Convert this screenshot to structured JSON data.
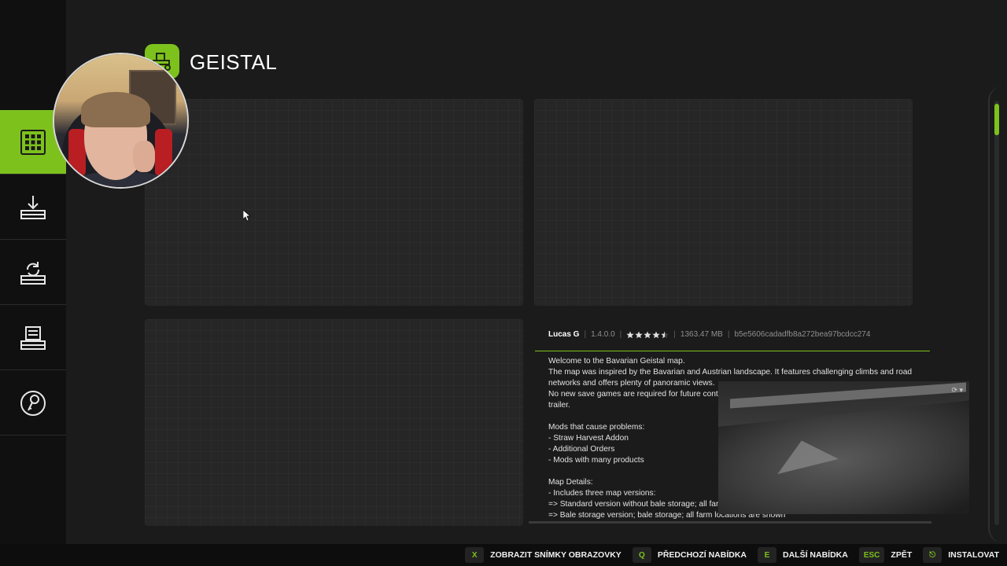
{
  "header": {
    "title": "GEISTAL"
  },
  "sidebar": {
    "items": [
      {
        "name": "mods-grid",
        "icon": "grid-icon",
        "active": true
      },
      {
        "name": "download",
        "icon": "download-icon",
        "active": false
      },
      {
        "name": "update",
        "icon": "refresh-icon",
        "active": false
      },
      {
        "name": "installed",
        "icon": "storage-icon",
        "active": false
      },
      {
        "name": "dlc",
        "icon": "key-icon",
        "active": false
      }
    ]
  },
  "details": {
    "author": "Lucas G",
    "version": "1.4.0.0",
    "rating": 4.5,
    "size": "1363.47 MB",
    "hash": "b5e5606cadadfb8a272bea97bcdcc274",
    "description_lines": [
      "Welcome to the Bavarian Geistal map.",
      "The map was inspired by the Bavarian and Austrian landscape. It features challenging climbs and road",
      "networks and offers plenty of panoramic views.",
      "No new save games are required for future cont",
      "trailer.",
      "",
      "Mods that cause problems:",
      "- Straw Harvest Addon",
      "- Additional Orders",
      "- Mods with many products",
      "",
      "Map Details:",
      "- Includes three map versions:",
      "=> Standard version without bale storage; all far",
      "=> Bale storage version; bale storage; all farm locations are shown"
    ]
  },
  "footer": {
    "actions": [
      {
        "key": "X",
        "label": "ZOBRAZIT SNÍMKY OBRAZOVKY"
      },
      {
        "key": "Q",
        "label": "PŘEDCHOZÍ NABÍDKA"
      },
      {
        "key": "E",
        "label": "DALŠÍ NABÍDKA"
      },
      {
        "key": "ESC",
        "label": "ZPĚT"
      },
      {
        "key": "⎋",
        "label": "INSTALOVAT"
      }
    ]
  },
  "colors": {
    "accent": "#7dc11d",
    "background": "#1b1b1b",
    "sidebar": "#101010"
  }
}
